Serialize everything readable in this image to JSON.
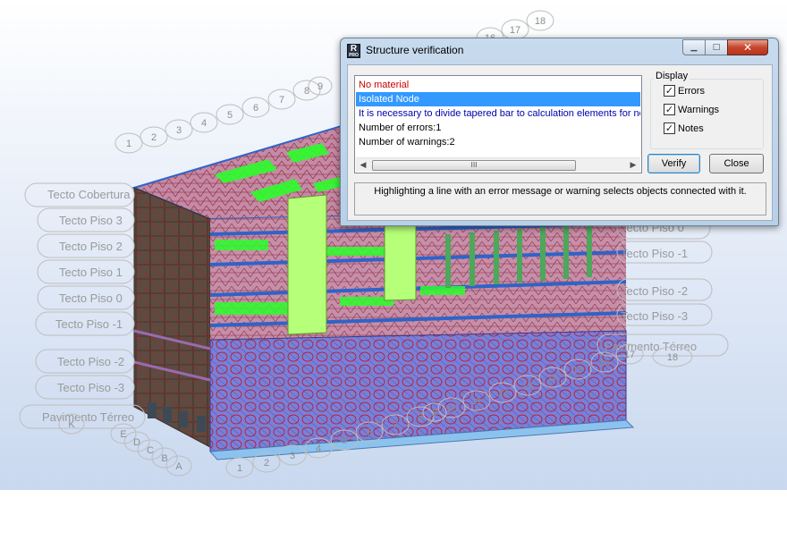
{
  "dialog": {
    "title": "Structure verification",
    "app_icon": {
      "letter": "R",
      "sub": "PRO"
    },
    "caption_buttons": {
      "minimize": "▁",
      "maximize": "□",
      "close": "✕"
    },
    "messages": [
      {
        "text": "No material",
        "color": "#cc0000"
      },
      {
        "text": "Isolated Node",
        "color": "#ffffff",
        "selected": true
      },
      {
        "text": "It is necessary to divide tapered bar to calculation elements for non",
        "color": "#0000aa"
      },
      {
        "text": "Number of errors:1",
        "color": "#000000"
      },
      {
        "text": "Number of warnings:2",
        "color": "#000000"
      }
    ],
    "scroll_grip": "III",
    "display": {
      "legend": "Display",
      "errors": {
        "label": "Errors",
        "checked": true
      },
      "warnings": {
        "label": "Warnings",
        "checked": true
      },
      "notes": {
        "label": "Notes",
        "checked": true
      }
    },
    "verify_label": "Verify",
    "close_label": "Close",
    "hint": "Highlighting a line with an error message or warning selects objects connected with it.",
    "selection_color": "#3399ff"
  },
  "model": {
    "levels_left": [
      "Tecto Cobertura",
      "Tecto Piso 3",
      "Tecto Piso 2",
      "Tecto Piso 1",
      "Tecto Piso 0",
      "Tecto Piso -1",
      "Tecto Piso -2",
      "Tecto Piso -3",
      "Pavimento Térreo"
    ],
    "levels_right": [
      "Tecto Piso 0",
      "Tecto Piso -1",
      "Tecto Piso -2",
      "Tecto Piso -3",
      "Pavimento Térreo"
    ],
    "axes_top": [
      "1",
      "2",
      "3",
      "4",
      "5",
      "6",
      "7",
      "8",
      "9",
      "16",
      "17",
      "18"
    ],
    "axes_bottom": [
      "1",
      "2",
      "3",
      "4",
      "5",
      "6",
      "7",
      "8",
      "9",
      "10",
      "11",
      "12",
      "13",
      "14",
      "15",
      "16",
      "17",
      "18"
    ],
    "axes_letters": [
      "K",
      "A",
      "B",
      "C",
      "D",
      "E"
    ],
    "colors": {
      "slab_pink": "#c58aa8",
      "opening_green": "#2cff2c",
      "mesh_red": "#c0101a",
      "wall_blue": "#8d8fe6",
      "beam_blue": "#2f63c8"
    }
  }
}
